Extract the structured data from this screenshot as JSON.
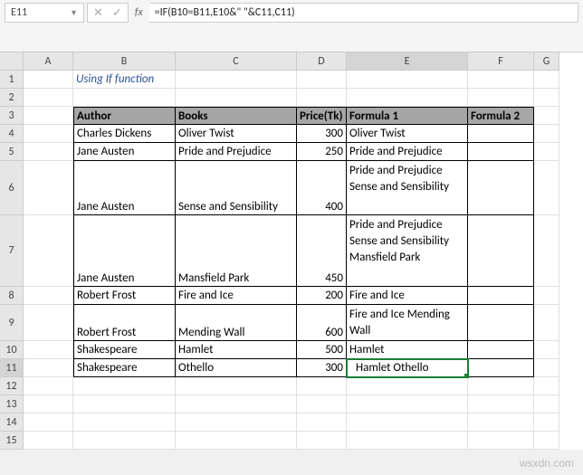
{
  "nameBox": "E11",
  "formula": "=IF(B10=B11,E10&\" \"&C11,C11)",
  "columns": [
    "A",
    "B",
    "C",
    "D",
    "E",
    "F",
    "G"
  ],
  "rows": [
    "1",
    "2",
    "3",
    "4",
    "5",
    "6",
    "7",
    "8",
    "9",
    "10",
    "11",
    "12",
    "13",
    "14",
    "15"
  ],
  "selectedCol": "E",
  "selectedRow": "11",
  "title": "Using If function",
  "headers": {
    "author": "Author",
    "books": "Books",
    "price": "Price(Tk)",
    "formula1": "Formula 1",
    "formula2": "Formula 2"
  },
  "table": [
    {
      "author": "Charles Dickens",
      "books": "Oliver Twist",
      "price": "300",
      "f1": "Oliver Twist"
    },
    {
      "author": "Jane Austen",
      "books": "Pride and Prejudice",
      "price": "250",
      "f1": "Pride and Prejudice"
    },
    {
      "author": "Jane Austen",
      "books": "Sense and Sensibility",
      "price": "400",
      "f1": "Pride and Prejudice Sense and Sensibility"
    },
    {
      "author": "Jane Austen",
      "books": "Mansfield Park",
      "price": "450",
      "f1": "Pride and Prejudice Sense and Sensibility Mansfield Park"
    },
    {
      "author": "Robert Frost",
      "books": "Fire and Ice",
      "price": "200",
      "f1": "Fire and Ice"
    },
    {
      "author": "Robert Frost",
      "books": "Mending Wall",
      "price": "600",
      "f1": "Fire and Ice Mending Wall"
    },
    {
      "author": "Shakespeare",
      "books": "Hamlet",
      "price": "500",
      "f1": "Hamlet"
    },
    {
      "author": "Shakespeare",
      "books": "Othello",
      "price": "300",
      "f1": "Hamlet Othello"
    }
  ],
  "watermark": "wsxdn.com"
}
